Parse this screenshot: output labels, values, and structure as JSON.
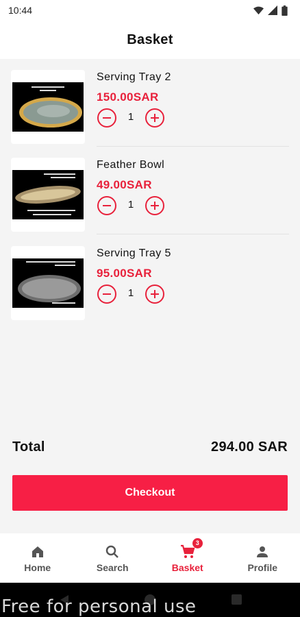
{
  "status_bar": {
    "time": "10:44",
    "icons": [
      "wifi-icon",
      "signal-icon",
      "battery-icon"
    ]
  },
  "header": {
    "title": "Basket"
  },
  "items": [
    {
      "name": "Serving Tray 2",
      "price": "150.00SAR",
      "quantity": "1",
      "image": "serving-tray-gold-photo"
    },
    {
      "name": "Feather Bowl",
      "price": "49.00SAR",
      "quantity": "1",
      "image": "feather-bowl-photo"
    },
    {
      "name": "Serving Tray 5",
      "price": "95.00SAR",
      "quantity": "1",
      "image": "serving-tray-crystal-photo"
    }
  ],
  "total": {
    "label": "Total",
    "value": "294.00 SAR"
  },
  "checkout": {
    "label": "Checkout"
  },
  "nav": {
    "items": [
      {
        "label": "Home",
        "icon": "home-icon"
      },
      {
        "label": "Search",
        "icon": "search-icon"
      },
      {
        "label": "Basket",
        "icon": "cart-icon",
        "badge": "3",
        "active": true
      },
      {
        "label": "Profile",
        "icon": "person-icon"
      }
    ]
  },
  "watermark": "Free for personal use",
  "colors": {
    "accent": "#e8213b",
    "checkout": "#f71f45",
    "background": "#f4f4f4"
  }
}
